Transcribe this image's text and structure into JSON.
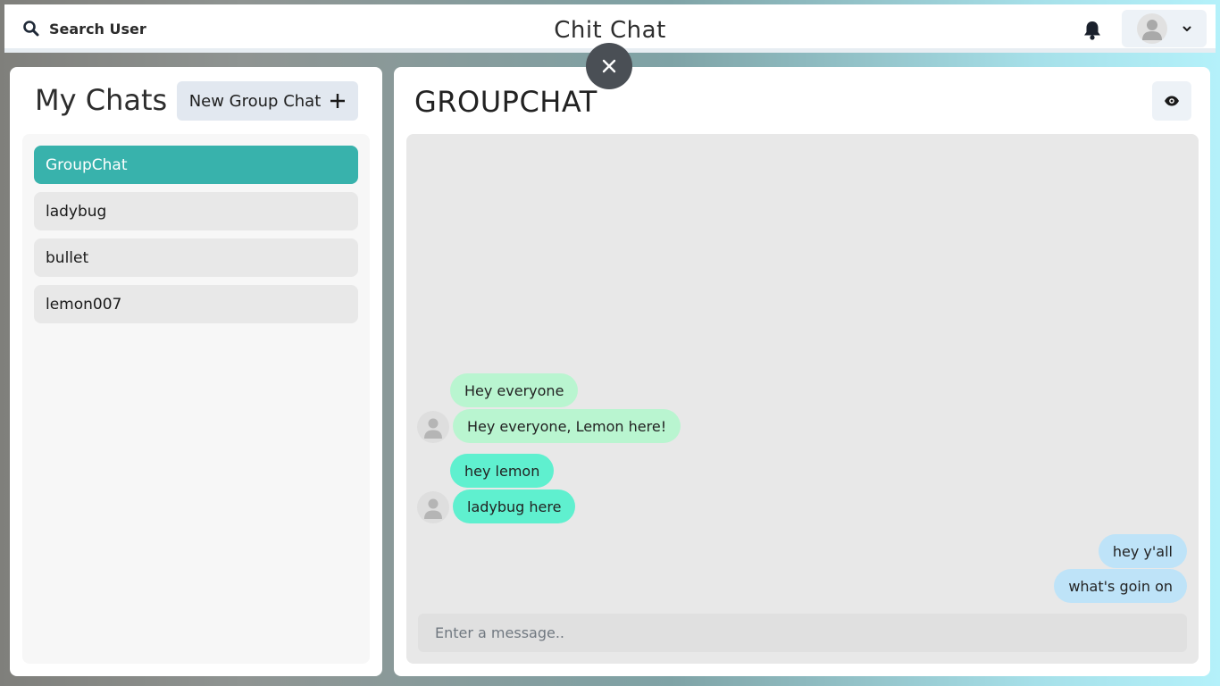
{
  "header": {
    "search_label": "Search User",
    "app_title": "Chit Chat",
    "icons": {
      "search": "search-icon",
      "notifications": "bell-icon",
      "profile": "avatar-icon",
      "menu": "chevron-down-icon",
      "close": "close-icon",
      "view": "eye-icon"
    }
  },
  "chats": {
    "title": "My Chats",
    "new_group_label": "New Group Chat",
    "items": [
      {
        "label": "GroupChat",
        "active": true
      },
      {
        "label": "ladybug",
        "active": false
      },
      {
        "label": "bullet",
        "active": false
      },
      {
        "label": "lemon007",
        "active": false
      }
    ]
  },
  "conversation": {
    "title": "GROUPCHAT",
    "messages": [
      {
        "text": "Hey everyone"
      },
      {
        "text": "Hey everyone, Lemon here!"
      },
      {
        "text": "hey lemon"
      },
      {
        "text": "ladybug here"
      },
      {
        "text": "hey y'all"
      },
      {
        "text": "what's goin on"
      }
    ],
    "input_placeholder": "Enter a message.."
  },
  "colors": {
    "active_chat": "#38b2ac",
    "bubble_lemon": "#b9f5d0",
    "bubble_ladybug": "#5ff0cf",
    "bubble_self": "#bee3f8"
  }
}
